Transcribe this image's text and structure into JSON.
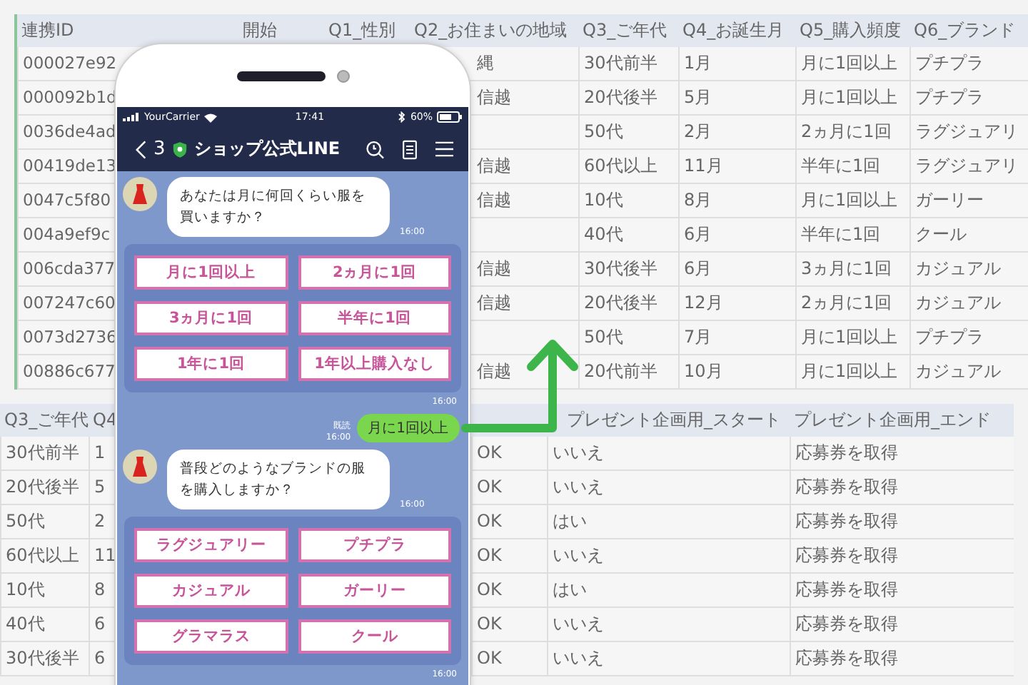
{
  "sheet_top": {
    "columns": [
      "連携ID",
      "開始",
      "Q1_性別",
      "Q2_お住まいの地域",
      "Q3_ご年代",
      "Q4_お誕生月",
      "Q5_購入頻度",
      "Q6_ブランド"
    ],
    "rows": [
      {
        "id": "000027e92",
        "region": "縄",
        "age": "30代前半",
        "birth_month": "1月",
        "frequency": "月に1回以上",
        "brand": "プチプラ"
      },
      {
        "id": "000092b1d",
        "region": "信越",
        "age": "20代後半",
        "birth_month": "5月",
        "frequency": "月に1回以上",
        "brand": "プチプラ"
      },
      {
        "id": "0036de4ad",
        "age": "50代",
        "birth_month": "2月",
        "frequency": "2ヵ月に1回",
        "brand": "ラグジュアリ"
      },
      {
        "id": "00419de13",
        "region": "信越",
        "age": "60代以上",
        "birth_month": "11月",
        "frequency": "半年に1回",
        "brand": "ラグジュアリ"
      },
      {
        "id": "0047c5f80",
        "region": "信越",
        "age": "10代",
        "birth_month": "8月",
        "frequency": "月に1回以上",
        "brand": "ガーリー"
      },
      {
        "id": "004a9ef9c",
        "age": "40代",
        "birth_month": "6月",
        "frequency": "半年に1回",
        "brand": "クール"
      },
      {
        "id": "006cda377",
        "region": "信越",
        "age": "30代後半",
        "birth_month": "6月",
        "frequency": "3ヵ月に1回",
        "brand": "カジュアル"
      },
      {
        "id": "007247c60",
        "region": "信越",
        "age": "20代後半",
        "birth_month": "12月",
        "frequency": "2ヵ月に1回",
        "brand": "カジュアル"
      },
      {
        "id": "0073d2736",
        "age": "50代",
        "birth_month": "7月",
        "frequency": "月に1回以上",
        "brand": "プチプラ"
      },
      {
        "id": "00886c677",
        "region": "信越",
        "age": "20代前半",
        "birth_month": "10月",
        "frequency": "月に1回以上",
        "brand": "カジュアル"
      }
    ]
  },
  "sheet_bottom": {
    "columns": [
      "Q3_ご年代",
      "Q4",
      "プレゼント企画用_スタート",
      "プレゼント企画用_エンド"
    ],
    "rows": [
      {
        "age": "30代前半",
        "column_2": "1",
        "column_3": "OK",
        "start": "いいえ",
        "end": "応募券を取得"
      },
      {
        "age": "20代後半",
        "column_2": "5",
        "column_3": "OK",
        "start": "いいえ",
        "end": "応募券を取得"
      },
      {
        "age": "50代",
        "column_2": "2",
        "column_3": "OK",
        "start": "はい",
        "end": "応募券を取得"
      },
      {
        "age": "60代以上",
        "column_2": "11",
        "column_3": "OK",
        "start": "いいえ",
        "end": "応募券を取得"
      },
      {
        "age": "10代",
        "column_2": "8",
        "column_3": "OK",
        "start": "はい",
        "end": "応募券を取得"
      },
      {
        "age": "40代",
        "column_2": "6",
        "column_3": "OK",
        "start": "いいえ",
        "end": "応募券を取得"
      },
      {
        "age": "30代後半",
        "column_2": "6",
        "column_3": "OK",
        "start": "いいえ",
        "end": "応募券を取得"
      }
    ]
  },
  "phone": {
    "status_bar": {
      "carrier": "YourCarrier",
      "time": "17:41",
      "battery": "60%"
    },
    "header": {
      "count": "3",
      "title": "ショップ公式LINE"
    },
    "messages": [
      {
        "kind": "received",
        "text": "あなたは月に何回くらい服を買いますか？",
        "time": "16:00"
      },
      {
        "kind": "quick_replies",
        "options": [
          "月に1回以上",
          "2ヵ月に1回",
          "3ヵ月に1回",
          "半年に1回",
          "1年に1回",
          "1年以上購入なし"
        ],
        "time": "16:00"
      },
      {
        "kind": "sent",
        "text": "月に1回以上",
        "read": "既読",
        "time": "16:00"
      },
      {
        "kind": "received",
        "text": "普段どのようなブランドの服を購入しますか？",
        "time": "16:00"
      },
      {
        "kind": "quick_replies",
        "options": [
          "ラグジュアリー",
          "プチプラ",
          "カジュアル",
          "ガーリー",
          "グラマラス",
          "クール"
        ],
        "time": "16:00"
      }
    ]
  }
}
